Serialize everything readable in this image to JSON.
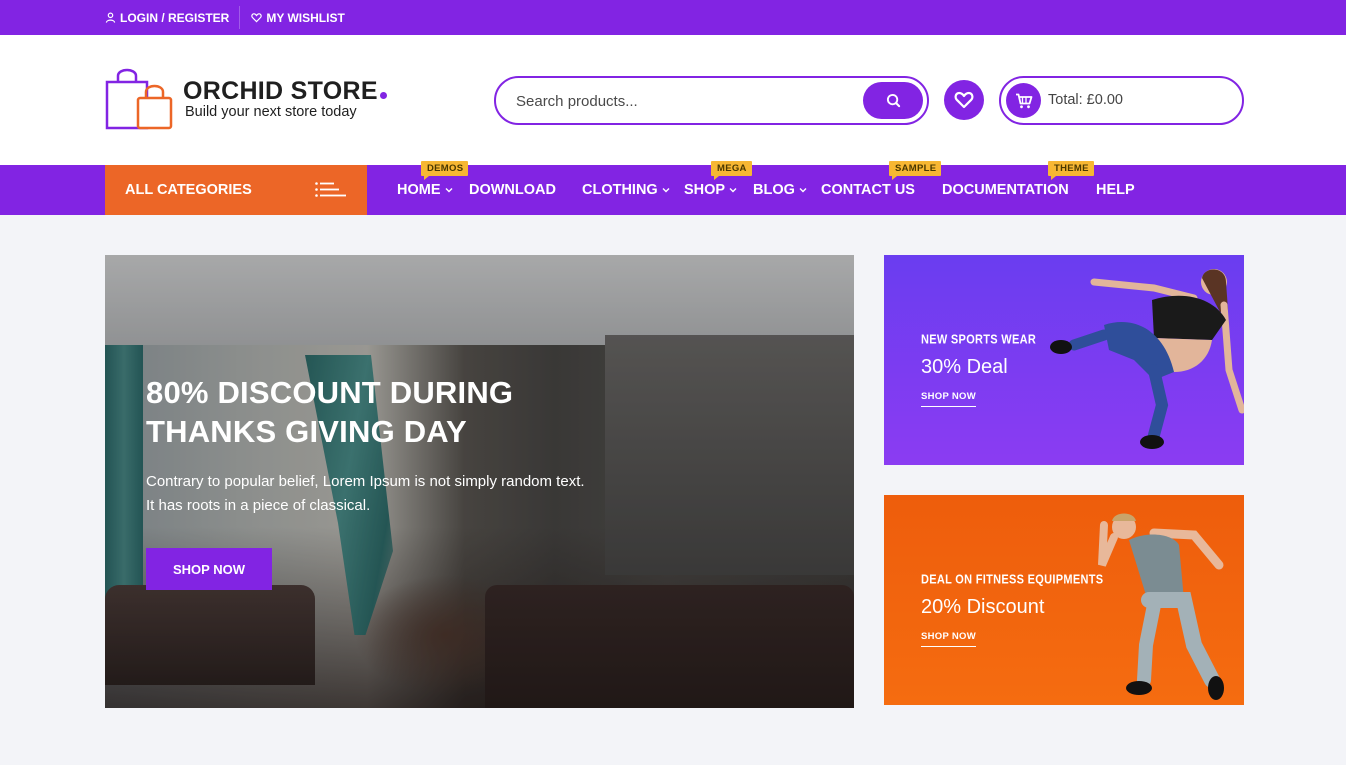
{
  "topbar": {
    "login_label": "LOGIN / REGISTER",
    "wishlist_label": "MY WISHLIST"
  },
  "header": {
    "logo_title": "ORCHID STORE",
    "logo_tagline": "Build your next store today",
    "search_placeholder": "Search products...",
    "cart_total": "Total: £0.00"
  },
  "nav": {
    "all_categories": "ALL CATEGORIES",
    "items": [
      {
        "label": "HOME",
        "dropdown": true,
        "badge": "DEMOS"
      },
      {
        "label": "DOWNLOAD",
        "dropdown": false,
        "badge": null
      },
      {
        "label": "CLOTHING",
        "dropdown": true,
        "badge": null
      },
      {
        "label": "SHOP",
        "dropdown": true,
        "badge": "MEGA"
      },
      {
        "label": "BLOG",
        "dropdown": true,
        "badge": null
      },
      {
        "label": "CONTACT US",
        "dropdown": false,
        "badge": "SAMPLE"
      },
      {
        "label": "DOCUMENTATION",
        "dropdown": false,
        "badge": "THEME"
      },
      {
        "label": "HELP",
        "dropdown": false,
        "badge": null
      }
    ]
  },
  "hero": {
    "title_line1": "80% DISCOUNT DURING",
    "title_line2": "THANKS GIVING DAY",
    "text": "Contrary to popular belief, Lorem Ipsum is not simply random text. It has roots in a piece of classical.",
    "button_label": "SHOP NOW"
  },
  "banners": [
    {
      "kicker": "NEW SPORTS WEAR",
      "title": "30% Deal",
      "link": "SHOP NOW"
    },
    {
      "kicker": "DEAL ON FITNESS EQUIPMENTS",
      "title": "20% Discount",
      "link": "SHOP NOW"
    }
  ],
  "colors": {
    "brand_purple": "#8224e3",
    "accent_orange": "#ec6627",
    "badge_yellow": "#f7b733",
    "page_bg": "#f3f4f8"
  }
}
